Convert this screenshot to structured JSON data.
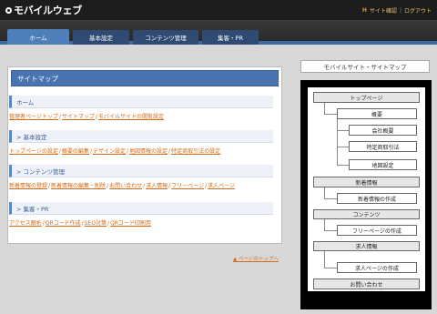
{
  "header": {
    "logo_text": "モバイルウェブ",
    "links": [
      {
        "label": "サイト確認"
      },
      {
        "label": "ログアウト"
      }
    ]
  },
  "tabs": [
    {
      "label": "ホーム",
      "active": true
    },
    {
      "label": "基本設定",
      "active": false
    },
    {
      "label": "コンテンツ管理",
      "active": false
    },
    {
      "label": "集客・PR",
      "active": false
    }
  ],
  "sitemap_panel": {
    "title": "サイトマップ",
    "sections": [
      {
        "title": "ホーム",
        "links": [
          "管理者ページトップ",
          "サイトマップ",
          "モバイルサイトの閲覧設定"
        ]
      },
      {
        "title": "> 基本設定",
        "links": [
          "トップページの設定",
          "概要の編集",
          "デザイン設定",
          "地図情報の設定",
          "特定商取引法の設定"
        ]
      },
      {
        "title": "> コンテンツ管理",
        "links": [
          "新着情報の登録",
          "新着情報の編集・削除",
          "お問い合わせ",
          "求人情報",
          "フリーページ",
          "求人ページ"
        ]
      },
      {
        "title": "> 集客・PR",
        "links": [
          "アクセス解析",
          "QRコード作成",
          "SEO対策",
          "QRコード印刷用"
        ]
      }
    ],
    "page_top": "▲ ページのトップへ"
  },
  "mobile_sitemap": {
    "title": "モバイルサイト・サイトマップ",
    "nodes": [
      {
        "label": "トップページ",
        "type": "main"
      },
      {
        "label": "概要",
        "type": "sub"
      },
      {
        "label": "会社概要",
        "type": "sub"
      },
      {
        "label": "特定商取引法",
        "type": "sub"
      },
      {
        "label": "地図設定",
        "type": "sub"
      },
      {
        "label": "新着情報",
        "type": "main"
      },
      {
        "label": "新着情報の作成",
        "type": "sub"
      },
      {
        "label": "コンテンツ",
        "type": "main"
      },
      {
        "label": "フリーページの作成",
        "type": "sub"
      },
      {
        "label": "求人情報",
        "type": "main"
      },
      {
        "label": "求人ページの作成",
        "type": "sub"
      },
      {
        "label": "お問い合わせ",
        "type": "main"
      }
    ]
  }
}
